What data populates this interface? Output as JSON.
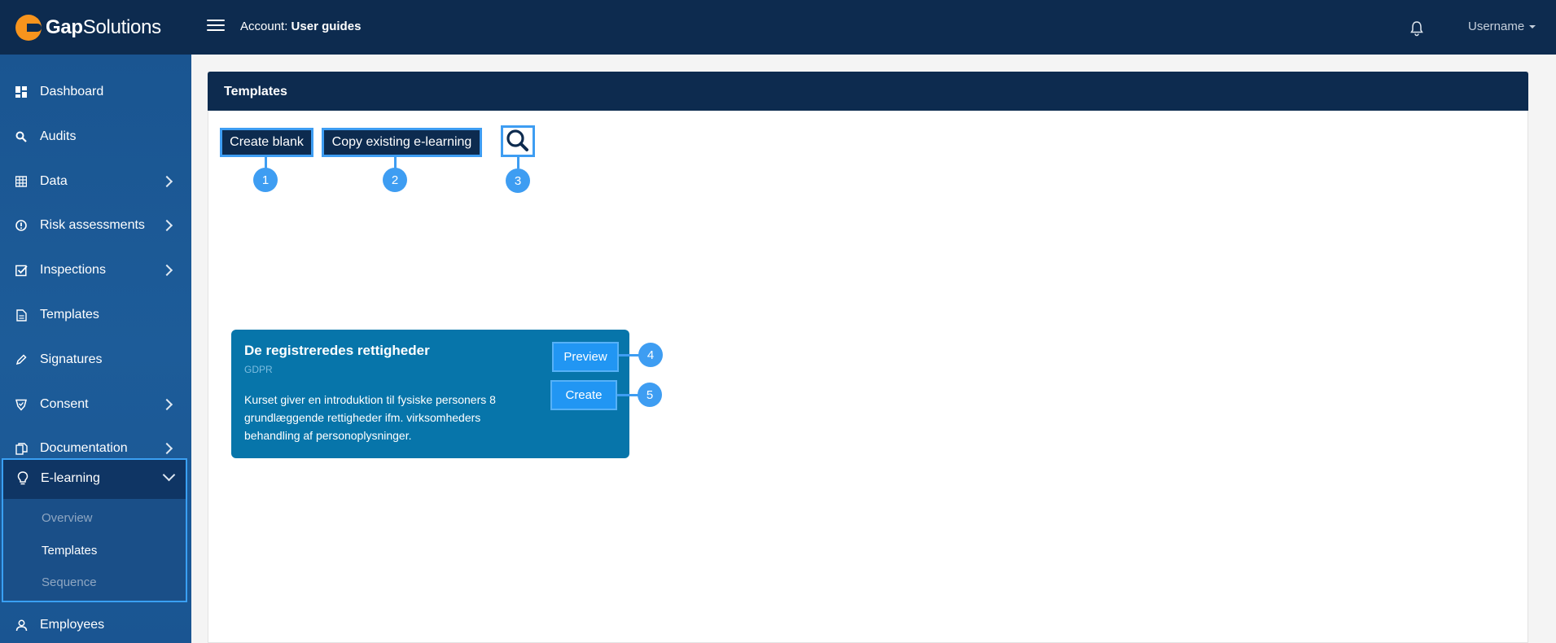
{
  "header": {
    "logo_bold": "Gap",
    "logo_light": "Solutions",
    "account_label": "Account:",
    "account_name": "User guides",
    "username": "Username"
  },
  "sidebar": {
    "items": [
      {
        "label": "Dashboard",
        "icon": "dashboard-icon"
      },
      {
        "label": "Audits",
        "icon": "search-icon"
      },
      {
        "label": "Data",
        "icon": "table-icon"
      },
      {
        "label": "Risk assessments",
        "icon": "alert-circle-icon"
      },
      {
        "label": "Inspections",
        "icon": "checkbox-icon"
      },
      {
        "label": "Templates",
        "icon": "document-icon"
      },
      {
        "label": "Signatures",
        "icon": "pen-icon"
      },
      {
        "label": "Consent",
        "icon": "shield-icon"
      },
      {
        "label": "Documentation",
        "icon": "files-icon"
      },
      {
        "label": "E-learning",
        "icon": "lightbulb-icon"
      },
      {
        "label": "Employees",
        "icon": "user-icon"
      }
    ],
    "elearning_sub": [
      "Overview",
      "Templates",
      "Sequence"
    ]
  },
  "main": {
    "title": "Templates",
    "create_blank": "Create blank",
    "copy_existing": "Copy existing e-learning",
    "callouts": [
      "1",
      "2",
      "3",
      "4",
      "5"
    ],
    "card": {
      "title": "De registreredes rettigheder",
      "category": "GDPR",
      "description": "Kurset giver en introduktion til fysiske personers 8 grundlæggende rettigheder ifm. virksomheders behandling af personoplysninger.",
      "preview": "Preview",
      "create": "Create"
    }
  },
  "colors": {
    "navy": "#0d2b4f",
    "sidebar_blue": "#1a5591",
    "accent": "#3e9df2",
    "card_blue": "#0775aa",
    "logo_orange": "#f7941d"
  }
}
